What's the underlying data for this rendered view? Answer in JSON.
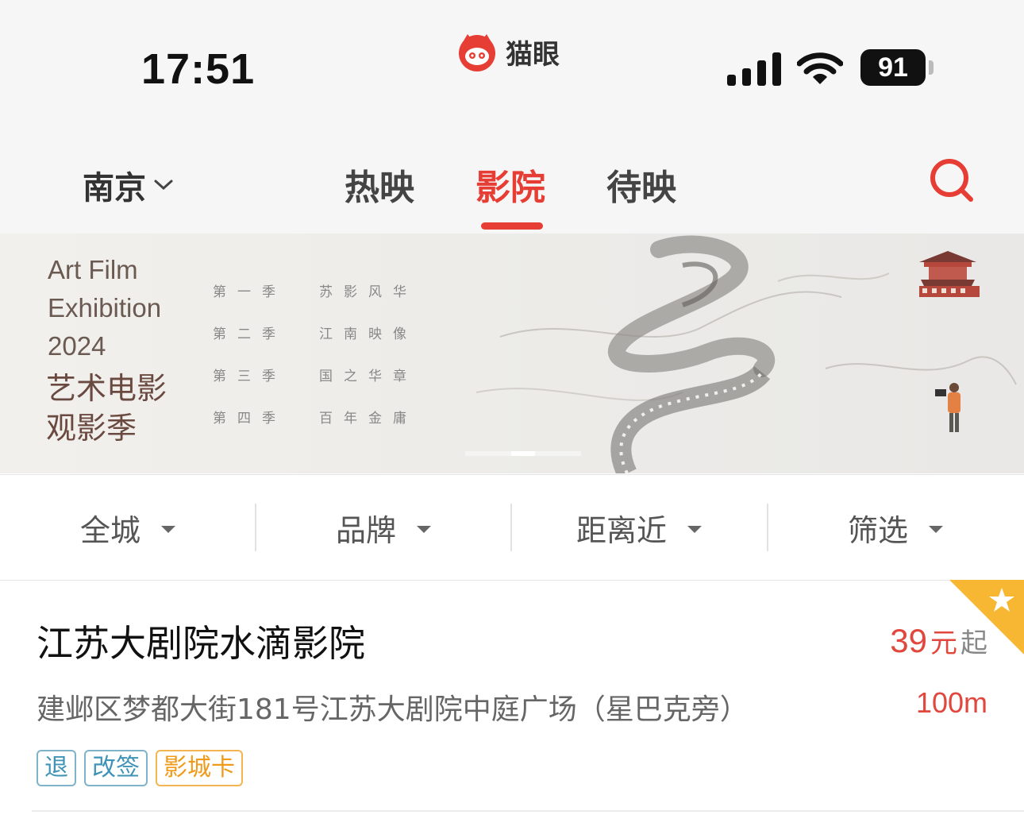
{
  "status_bar": {
    "time": "17:51",
    "app_name": "猫眼",
    "battery": "91",
    "icons": [
      "cellular-signal-icon",
      "wifi-icon",
      "battery-icon"
    ]
  },
  "nav": {
    "city": "南京",
    "tabs": [
      {
        "label": "热映",
        "active": false
      },
      {
        "label": "影院",
        "active": true
      },
      {
        "label": "待映",
        "active": false
      }
    ],
    "accent_color": "#e63e35"
  },
  "banner": {
    "title_en_lines": [
      "Art Film",
      "Exhibition",
      "2024"
    ],
    "title_cn_lines": [
      "艺术电影",
      "观影季"
    ],
    "seasons": [
      "第一季",
      "第二季",
      "第三季",
      "第四季"
    ],
    "themes": [
      "苏影风华",
      "江南映像",
      "国之华章",
      "百年金庸"
    ]
  },
  "filters": [
    {
      "label": "全城"
    },
    {
      "label": "品牌"
    },
    {
      "label": "距离近"
    },
    {
      "label": "筛选"
    }
  ],
  "cinemas": [
    {
      "name": "江苏大剧院水滴影院",
      "price_num": "39",
      "price_unit": "元",
      "price_suffix": "起",
      "address": "建邺区梦都大街181号江苏大剧院中庭广场（星巴克旁）",
      "distance": "100m",
      "tags": [
        {
          "label": "退",
          "style": "blue"
        },
        {
          "label": "改签",
          "style": "blue"
        },
        {
          "label": "影城卡",
          "style": "gold"
        }
      ],
      "favorite": true
    }
  ]
}
